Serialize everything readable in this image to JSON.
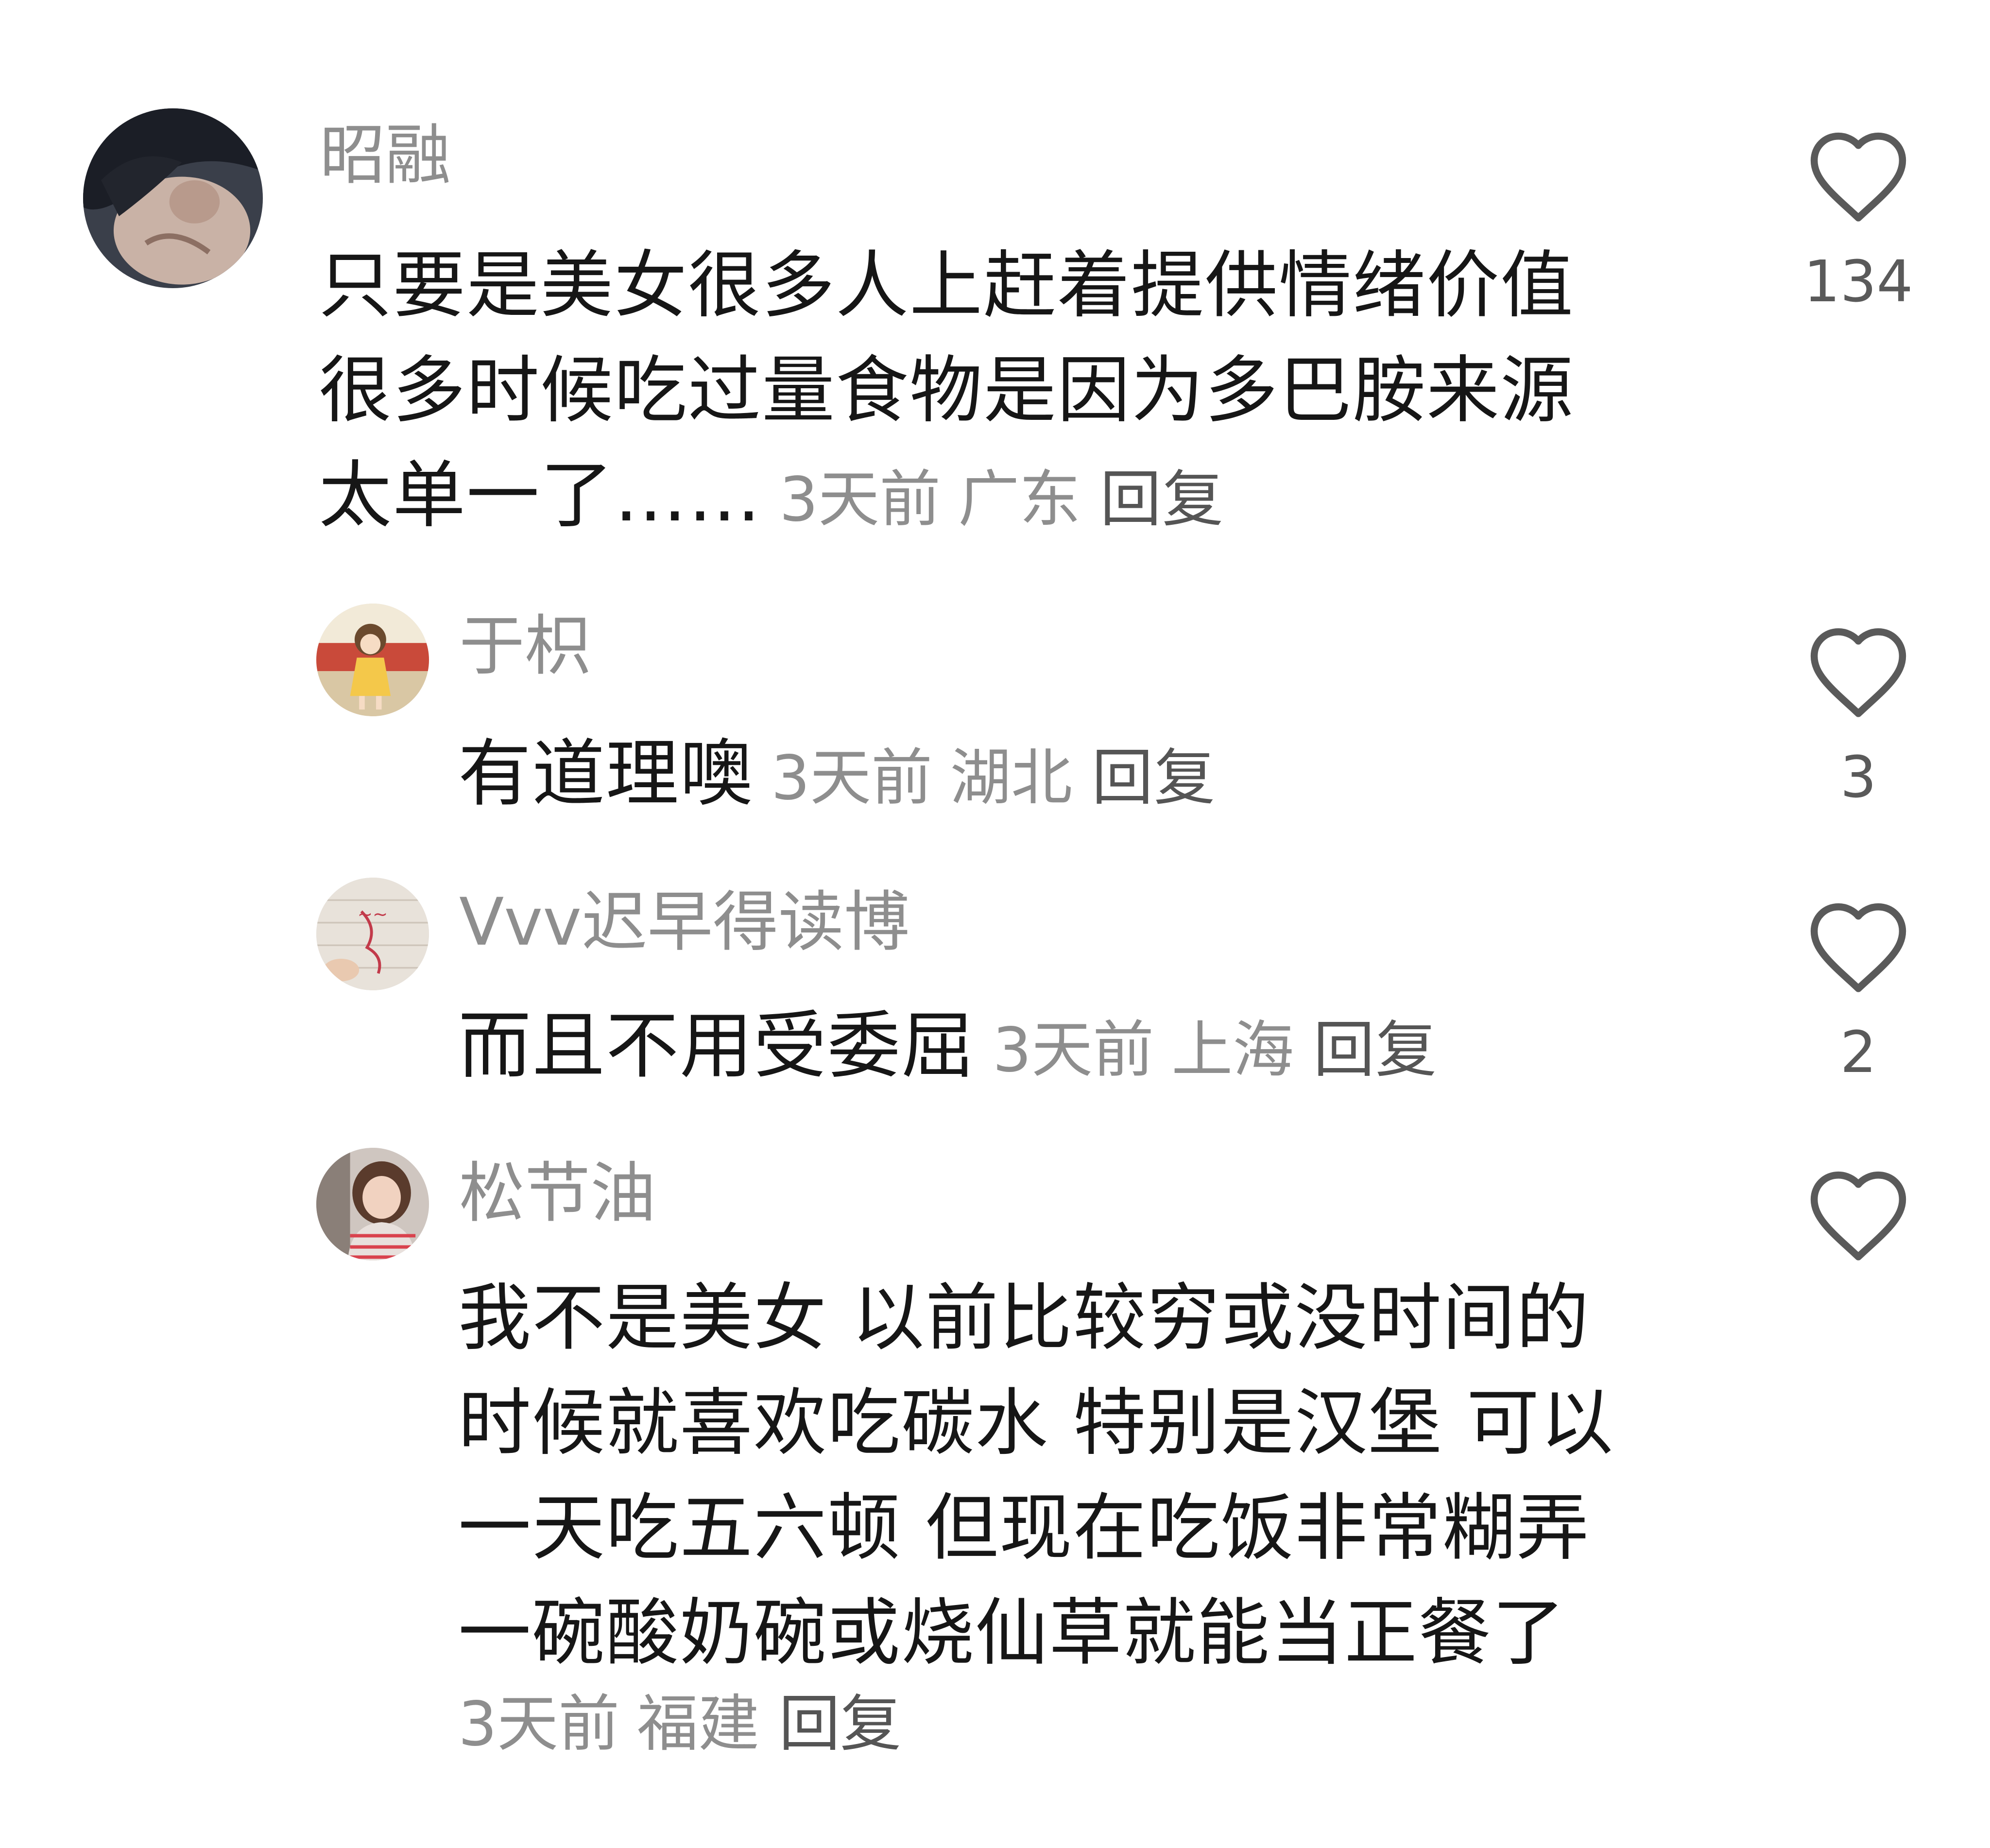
{
  "comments": [
    {
      "username": "昭融",
      "text_lines": [
        "只要是美女很多人上赶着提供情绪价值",
        "很多时候吃过量食物是因为多巴胺来源",
        "太单一了……"
      ],
      "time": "3天前",
      "location": "广东",
      "reply_label": "回复",
      "like_count": "134"
    },
    {
      "username": "于枳",
      "text": "有道理噢",
      "time": "3天前",
      "location": "湖北",
      "reply_label": "回复",
      "like_count": "3"
    },
    {
      "username": "Vvv迟早得读博",
      "text": "而且不用受委屈",
      "time": "3天前",
      "location": "上海",
      "reply_label": "回复",
      "like_count": "2"
    },
    {
      "username": "松节油",
      "text_lines": [
        "我不是美女 以前比较穷或没时间的",
        "时候就喜欢吃碳水 特别是汉堡 可以",
        "一天吃五六顿 但现在吃饭非常糊弄",
        "一碗酸奶碗或烧仙草就能当正餐了"
      ],
      "time": "3天前",
      "location": "福建",
      "reply_label": "回复",
      "like_count": ""
    }
  ],
  "icons": {
    "like": "heart-outline-icon"
  },
  "colors": {
    "text": "#161616",
    "secondary": "#8e8e8e",
    "reply": "#555555",
    "icon": "#5a5a5a"
  }
}
